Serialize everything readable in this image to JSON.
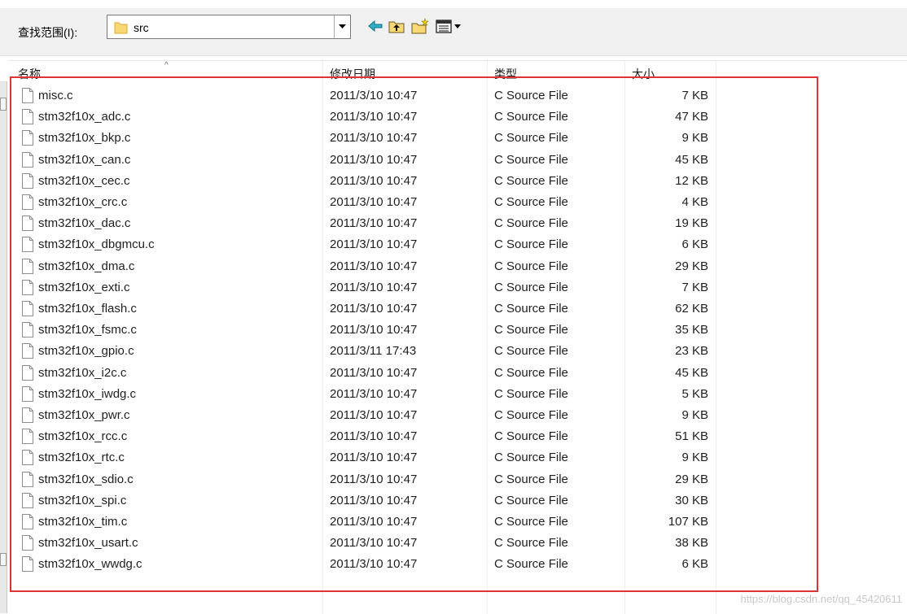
{
  "toolbar": {
    "look_in_label": "查找范围(I):",
    "current_folder": "src"
  },
  "columns": {
    "name": "名称",
    "date": "修改日期",
    "type": "类型",
    "size": "大小"
  },
  "files": [
    {
      "name": "misc.c",
      "date": "2011/3/10 10:47",
      "type": "C Source File",
      "size": "7 KB"
    },
    {
      "name": "stm32f10x_adc.c",
      "date": "2011/3/10 10:47",
      "type": "C Source File",
      "size": "47 KB"
    },
    {
      "name": "stm32f10x_bkp.c",
      "date": "2011/3/10 10:47",
      "type": "C Source File",
      "size": "9 KB"
    },
    {
      "name": "stm32f10x_can.c",
      "date": "2011/3/10 10:47",
      "type": "C Source File",
      "size": "45 KB"
    },
    {
      "name": "stm32f10x_cec.c",
      "date": "2011/3/10 10:47",
      "type": "C Source File",
      "size": "12 KB"
    },
    {
      "name": "stm32f10x_crc.c",
      "date": "2011/3/10 10:47",
      "type": "C Source File",
      "size": "4 KB"
    },
    {
      "name": "stm32f10x_dac.c",
      "date": "2011/3/10 10:47",
      "type": "C Source File",
      "size": "19 KB"
    },
    {
      "name": "stm32f10x_dbgmcu.c",
      "date": "2011/3/10 10:47",
      "type": "C Source File",
      "size": "6 KB"
    },
    {
      "name": "stm32f10x_dma.c",
      "date": "2011/3/10 10:47",
      "type": "C Source File",
      "size": "29 KB"
    },
    {
      "name": "stm32f10x_exti.c",
      "date": "2011/3/10 10:47",
      "type": "C Source File",
      "size": "7 KB"
    },
    {
      "name": "stm32f10x_flash.c",
      "date": "2011/3/10 10:47",
      "type": "C Source File",
      "size": "62 KB"
    },
    {
      "name": "stm32f10x_fsmc.c",
      "date": "2011/3/10 10:47",
      "type": "C Source File",
      "size": "35 KB"
    },
    {
      "name": "stm32f10x_gpio.c",
      "date": "2011/3/11 17:43",
      "type": "C Source File",
      "size": "23 KB"
    },
    {
      "name": "stm32f10x_i2c.c",
      "date": "2011/3/10 10:47",
      "type": "C Source File",
      "size": "45 KB"
    },
    {
      "name": "stm32f10x_iwdg.c",
      "date": "2011/3/10 10:47",
      "type": "C Source File",
      "size": "5 KB"
    },
    {
      "name": "stm32f10x_pwr.c",
      "date": "2011/3/10 10:47",
      "type": "C Source File",
      "size": "9 KB"
    },
    {
      "name": "stm32f10x_rcc.c",
      "date": "2011/3/10 10:47",
      "type": "C Source File",
      "size": "51 KB"
    },
    {
      "name": "stm32f10x_rtc.c",
      "date": "2011/3/10 10:47",
      "type": "C Source File",
      "size": "9 KB"
    },
    {
      "name": "stm32f10x_sdio.c",
      "date": "2011/3/10 10:47",
      "type": "C Source File",
      "size": "29 KB"
    },
    {
      "name": "stm32f10x_spi.c",
      "date": "2011/3/10 10:47",
      "type": "C Source File",
      "size": "30 KB"
    },
    {
      "name": "stm32f10x_tim.c",
      "date": "2011/3/10 10:47",
      "type": "C Source File",
      "size": "107 KB"
    },
    {
      "name": "stm32f10x_usart.c",
      "date": "2011/3/10 10:47",
      "type": "C Source File",
      "size": "38 KB"
    },
    {
      "name": "stm32f10x_wwdg.c",
      "date": "2011/3/10 10:47",
      "type": "C Source File",
      "size": "6 KB"
    }
  ],
  "watermark": "https://blog.csdn.net/qq_45420611",
  "colors": {
    "highlight": "#e03434",
    "folder": "#f3c64d"
  }
}
